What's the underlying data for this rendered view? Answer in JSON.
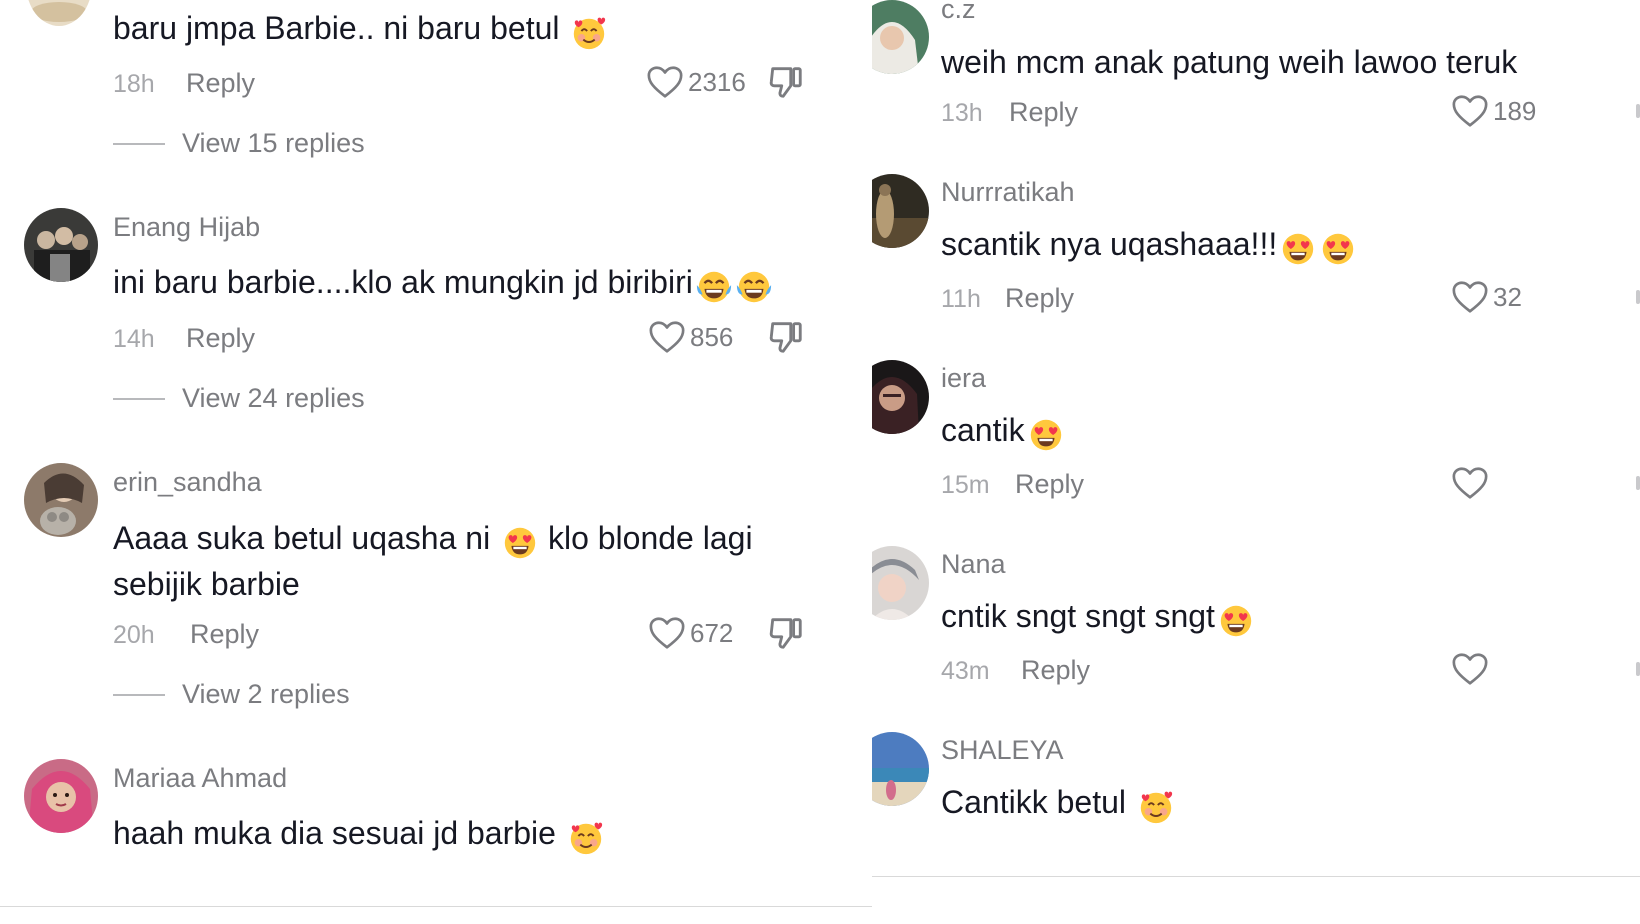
{
  "left_panel": {
    "comments": [
      {
        "username": "",
        "text": "baru jmpa Barbie.. ni baru betul",
        "emojis": [
          "smiling-hearts"
        ],
        "time": "18h",
        "reply": "Reply",
        "likes": "2316",
        "view_replies": "View 15 replies"
      },
      {
        "username": "Enang Hijab",
        "text": "ini baru barbie....klo ak mungkin jd biribiri",
        "emojis": [
          "tears-of-joy",
          "tears-of-joy"
        ],
        "time": "14h",
        "reply": "Reply",
        "likes": "856",
        "view_replies": "View 24 replies"
      },
      {
        "username": "erin_sandha",
        "text": "Aaaa suka betul uqasha ni",
        "emojis": [
          "heart-eyes"
        ],
        "text_after_emoji": "klo blonde lagi",
        "text_line2": "sebijik barbie",
        "time": "20h",
        "reply": "Reply",
        "likes": "672",
        "view_replies": "View 2 replies"
      },
      {
        "username": "Mariaa Ahmad",
        "text": "haah muka dia sesuai jd barbie",
        "emojis": [
          "smiling-hearts"
        ]
      }
    ]
  },
  "right_panel": {
    "comments": [
      {
        "username": "c.z",
        "text": "weih mcm anak patung weih lawoo teruk",
        "emojis": [],
        "time": "13h",
        "reply": "Reply",
        "likes": "189"
      },
      {
        "username": "Nurrratikah",
        "text": "scantik nya uqashaaa!!!",
        "emojis": [
          "heart-eyes",
          "heart-eyes"
        ],
        "time": "11h",
        "reply": "Reply",
        "likes": "32"
      },
      {
        "username": "iera",
        "text": "cantik",
        "emojis": [
          "heart-eyes"
        ],
        "time": "15m",
        "reply": "Reply",
        "likes": ""
      },
      {
        "username": "Nana",
        "text": "cntik sngt sngt sngt",
        "emojis": [
          "heart-eyes"
        ],
        "time": "43m",
        "reply": "Reply",
        "likes": ""
      },
      {
        "username": "SHALEYA",
        "text": "Cantikk betul",
        "emojis": [
          "smiling-hearts"
        ]
      }
    ]
  },
  "colors": {
    "text": "#161823",
    "secondary": "#7b7c80",
    "time": "#a6a7ab",
    "divider": "#d9d9d9"
  }
}
